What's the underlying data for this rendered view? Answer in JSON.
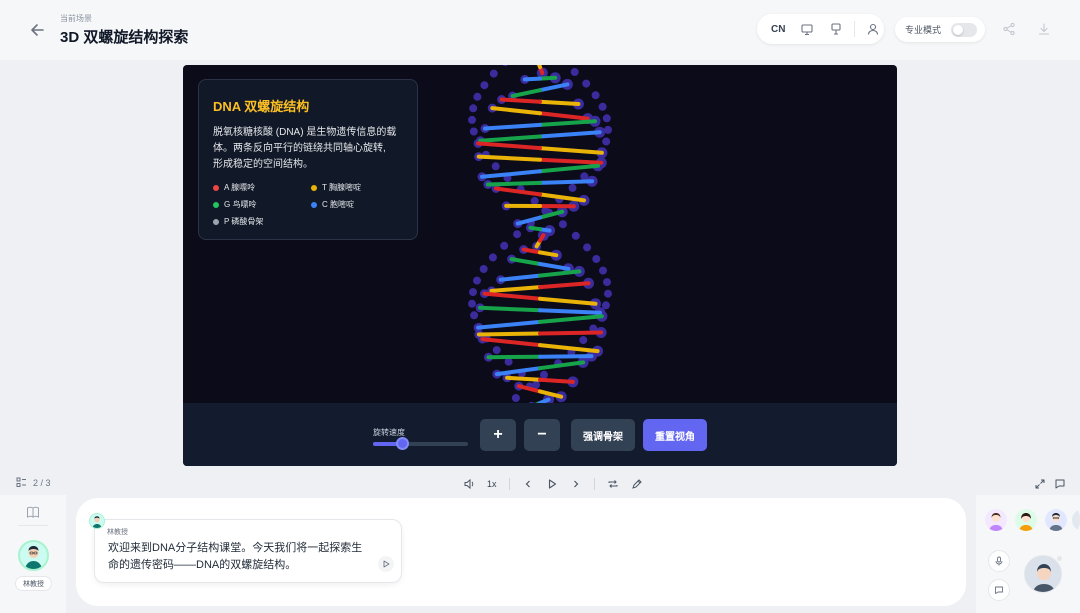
{
  "header": {
    "scene_label": "当前场景",
    "title": "3D 双螺旋结构探索",
    "lang": "CN",
    "pro_mode_label": "专业模式",
    "pro_mode_on": false
  },
  "info": {
    "title": "DNA 双螺旋结构",
    "desc_line1": "脱氧核糖核酸 (DNA) 是生物遗传信息的载",
    "desc_line2": "体。两条反向平行的链绕共同轴心旋转,",
    "desc_line3": "形成稳定的空间结构。",
    "legend": [
      {
        "label": "A 腺嘌呤",
        "color": "#ef4444"
      },
      {
        "label": "T 胸腺嘧啶",
        "color": "#eab308"
      },
      {
        "label": "G 鸟嘌呤",
        "color": "#22c55e"
      },
      {
        "label": "C 胞嘧啶",
        "color": "#3b82f6"
      },
      {
        "label": "P 磷酸骨架",
        "color": "#9ca3af"
      }
    ]
  },
  "controls": {
    "speed_label": "旋转速度",
    "speed_value": 0.3,
    "plus_label": "+",
    "minus_label": "−",
    "emphasize_label": "强调骨架",
    "reset_label": "重置视角"
  },
  "colors": {
    "backbone": "#3b2c9e",
    "A": "#dc2626",
    "T": "#eab308",
    "G": "#16a34a",
    "C": "#3b82f6",
    "accent": "#6366f1"
  },
  "toolbar": {
    "page": "2 / 3",
    "rate": "1x"
  },
  "bottom": {
    "teacher_name": "林教授",
    "bubble_line1": "欢迎来到DNA分子结构课堂。今天我们将一起探索生",
    "bubble_line2": "命的遗传密码——DNA的双螺旋结构。"
  }
}
